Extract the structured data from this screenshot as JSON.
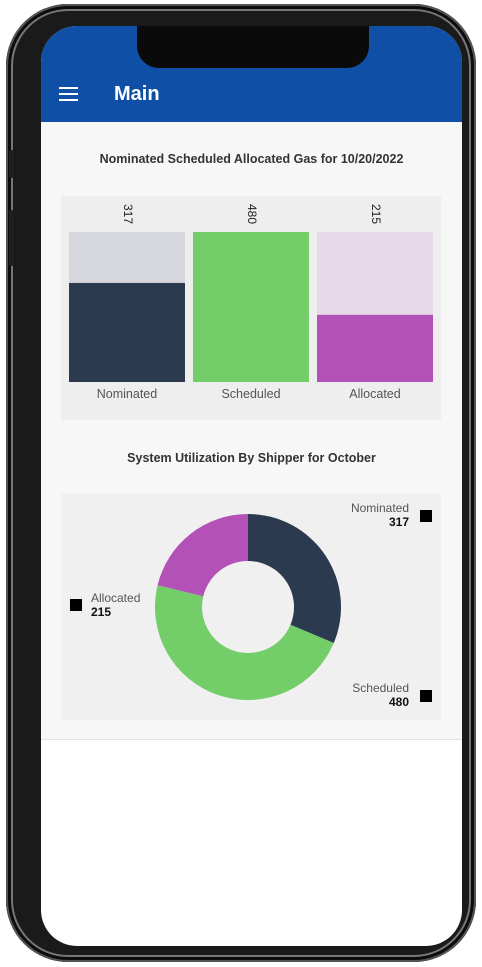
{
  "app": {
    "title": "Main"
  },
  "bar_section": {
    "title": "Nominated Scheduled Allocated Gas for 10/20/2022"
  },
  "pie_section": {
    "title": "System Utilization By Shipper for October"
  },
  "colors": {
    "appbar": "#0f4fa6",
    "nominated": "#2c3a4f",
    "nominated_bg": "#d5d7dc",
    "scheduled": "#73cd69",
    "allocated": "#b351b6",
    "allocated_bg": "#e8d9ea"
  },
  "chart_data": [
    {
      "type": "bar",
      "title": "Nominated Scheduled Allocated Gas for 10/20/2022",
      "categories": [
        "Nominated",
        "Scheduled",
        "Allocated"
      ],
      "values": [
        317,
        480,
        215
      ],
      "ylim": [
        0,
        480
      ]
    },
    {
      "type": "pie",
      "title": "System Utilization By Shipper for October",
      "labels": [
        "Nominated",
        "Scheduled",
        "Allocated"
      ],
      "values": [
        317,
        480,
        215
      ],
      "donut": true
    }
  ]
}
